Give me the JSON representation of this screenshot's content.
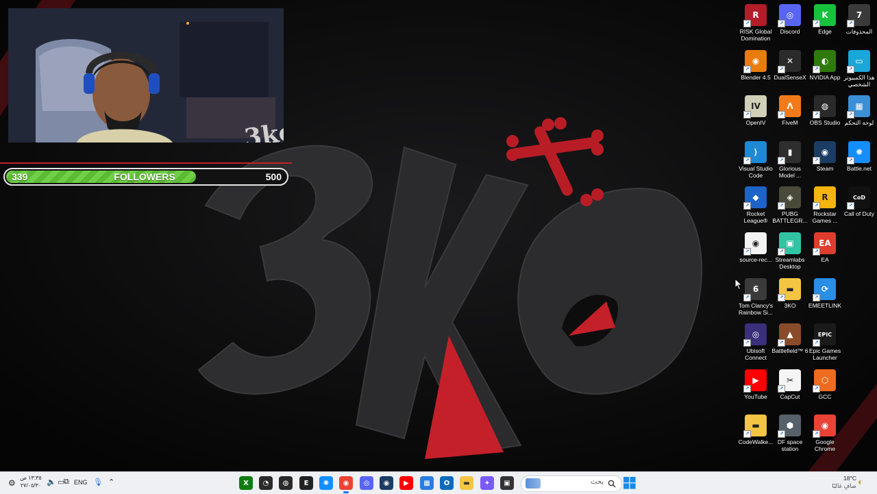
{
  "stream_overlay": {
    "followers_current": "339",
    "followers_label": "FOLLOWERS",
    "followers_goal": "500",
    "progress_fraction": 0.678,
    "accent_color": "#c4202a",
    "bar_color": "#6fcf45"
  },
  "wallpaper": {
    "logo_icon": "3ko-bone-logo"
  },
  "desktop": {
    "icons": [
      {
        "label": "RISK Global Domination",
        "icon": "risk-icon",
        "color": "#b41c2a",
        "glyph": "R"
      },
      {
        "label": "Discord",
        "icon": "discord-icon",
        "color": "#5865f2",
        "glyph": "◎"
      },
      {
        "label": "Edge",
        "icon": "edge-icon",
        "color": "#17c13c",
        "glyph": "K"
      },
      {
        "label": "المحذوفات",
        "icon": "recycle-bin-icon",
        "color": "#3a3a3a",
        "glyph": "7"
      },
      {
        "label": "Blender 4.5",
        "icon": "blender-icon",
        "color": "#e87d0d",
        "glyph": "◉"
      },
      {
        "label": "DualSenseX",
        "icon": "dualsensex-icon",
        "color": "#2b2b2b",
        "glyph": "✕"
      },
      {
        "label": "NVIDIA App",
        "icon": "nvidia-icon",
        "color": "#2f7a0d",
        "glyph": "◐"
      },
      {
        "label": "هذا الكمبيوتر الشخصي",
        "icon": "this-pc-icon",
        "color": "#19a7d8",
        "glyph": "▭"
      },
      {
        "label": "OpenIV",
        "icon": "openiv-icon",
        "color": "#d2cfb8",
        "glyph": "IV"
      },
      {
        "label": "FiveM",
        "icon": "fivem-icon",
        "color": "#f27a1a",
        "glyph": "Λ"
      },
      {
        "label": "OBS Studio",
        "icon": "obs-icon",
        "color": "#2a2a2a",
        "glyph": "◍"
      },
      {
        "label": "لوحة التحكم",
        "icon": "control-panel-icon",
        "color": "#3b8fd6",
        "glyph": "▦"
      },
      {
        "label": "Visual Studio Code",
        "icon": "vscode-icon",
        "color": "#1e8ad6",
        "glyph": "⟩"
      },
      {
        "label": "Glorious Model ...",
        "icon": "glorious-icon",
        "color": "#2e2e2e",
        "glyph": "▮"
      },
      {
        "label": "Steam",
        "icon": "steam-icon",
        "color": "#1b3c63",
        "glyph": "◉"
      },
      {
        "label": "Battle.net",
        "icon": "battlenet-icon",
        "color": "#148eff",
        "glyph": "✺"
      },
      {
        "label": "Rocket League®",
        "icon": "rocket-league-icon",
        "color": "#1d63c8",
        "glyph": "◆"
      },
      {
        "label": "PUBG BATTLEGR...",
        "icon": "pubg-icon",
        "color": "#4a4a3a",
        "glyph": "◈"
      },
      {
        "label": "Rockstar Games ...",
        "icon": "rockstar-icon",
        "color": "#f5b50e",
        "glyph": "R"
      },
      {
        "label": "Call of Duty",
        "icon": "call-of-duty-icon",
        "color": "#111111",
        "glyph": "CoD"
      },
      {
        "label": "source-rec...",
        "icon": "source-record-icon",
        "color": "#f2f2f2",
        "glyph": "◉"
      },
      {
        "label": "Streamlabs Desktop",
        "icon": "streamlabs-icon",
        "color": "#31c3a2",
        "glyph": "▣"
      },
      {
        "label": "EA",
        "icon": "ea-icon",
        "color": "#e03c2e",
        "glyph": "EA"
      },
      {
        "label": "",
        "icon": "empty-slot",
        "color": "",
        "glyph": ""
      },
      {
        "label": "Tom Clancy's Rainbow Si...",
        "icon": "rainbow-six-icon",
        "color": "#3a3a3a",
        "glyph": "6"
      },
      {
        "label": "3KO",
        "icon": "folder-icon",
        "color": "#f4c542",
        "glyph": "▬"
      },
      {
        "label": "EMEETLINK",
        "icon": "emeetlink-icon",
        "color": "#2a8de6",
        "glyph": "⟳"
      },
      {
        "label": "",
        "icon": "empty-slot",
        "color": "",
        "glyph": ""
      },
      {
        "label": "Ubisoft Connect",
        "icon": "ubisoft-icon",
        "color": "#3a2f7a",
        "glyph": "◎"
      },
      {
        "label": "Battlefield™ 6",
        "icon": "battlefield-icon",
        "color": "#8a4b2a",
        "glyph": "▲"
      },
      {
        "label": "Epic Games Launcher",
        "icon": "epic-games-icon",
        "color": "#1a1a1a",
        "glyph": "EPIC"
      },
      {
        "label": "",
        "icon": "empty-slot",
        "color": "",
        "glyph": ""
      },
      {
        "label": "YouTube",
        "icon": "youtube-icon",
        "color": "#ff0000",
        "glyph": "▶"
      },
      {
        "label": "CapCut",
        "icon": "capcut-icon",
        "color": "#f5f5f5",
        "glyph": "✂"
      },
      {
        "label": "GCC",
        "icon": "gcc-icon",
        "color": "#ef6b1f",
        "glyph": "⬡"
      },
      {
        "label": "",
        "icon": "empty-slot",
        "color": "",
        "glyph": ""
      },
      {
        "label": "CodeWalke...",
        "icon": "folder-icon",
        "color": "#f4c542",
        "glyph": "▬"
      },
      {
        "label": "DF space station",
        "icon": "df-space-station-icon",
        "color": "#55606a",
        "glyph": "⬢"
      },
      {
        "label": "Google Chrome",
        "icon": "chrome-icon",
        "color": "#ea4335",
        "glyph": "◉"
      }
    ]
  },
  "taskbar": {
    "search_placeholder": "بحث",
    "apps": [
      {
        "name": "xbox-app-icon",
        "color": "#107c10",
        "glyph": "X"
      },
      {
        "name": "speedometer-app-icon",
        "color": "#2a2a2a",
        "glyph": "◔"
      },
      {
        "name": "obs-app-icon",
        "color": "#2a2a2a",
        "glyph": "◍"
      },
      {
        "name": "epic-games-app-icon",
        "color": "#222222",
        "glyph": "E"
      },
      {
        "name": "battlenet-app-icon",
        "color": "#148eff",
        "glyph": "✺"
      },
      {
        "name": "chrome-app-icon",
        "color": "#ea4335",
        "glyph": "◉"
      },
      {
        "name": "discord-app-icon",
        "color": "#5865f2",
        "glyph": "◎"
      },
      {
        "name": "steam-app-icon",
        "color": "#1b3c63",
        "glyph": "◉"
      },
      {
        "name": "youtube-app-icon",
        "color": "#ff0000",
        "glyph": "▶"
      },
      {
        "name": "store-app-icon",
        "color": "#2a7de1",
        "glyph": "▦"
      },
      {
        "name": "outlook-app-icon",
        "color": "#0f6cbd",
        "glyph": "O"
      },
      {
        "name": "file-explorer-app-icon",
        "color": "#f4c542",
        "glyph": "▬"
      },
      {
        "name": "copilot-app-icon",
        "color": "#7a5af8",
        "glyph": "✦"
      },
      {
        "name": "terminal-app-icon",
        "color": "#333333",
        "glyph": "▣"
      }
    ],
    "weather_temp": "18°C",
    "weather_desc": "صافٍ غالبًا",
    "language": "ENG",
    "time": "١٣:٣٥ ص",
    "date": "٢٧/٠٥/٣٠"
  }
}
